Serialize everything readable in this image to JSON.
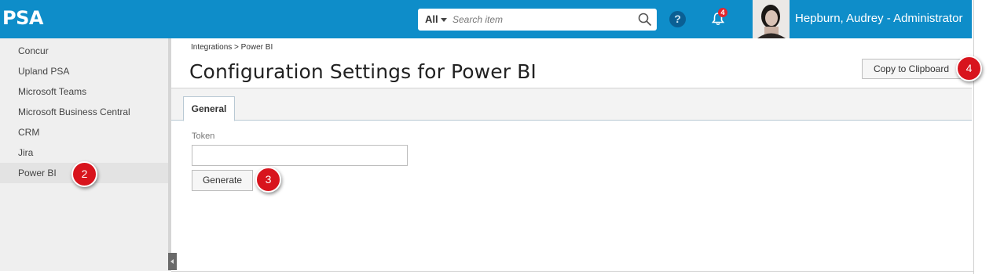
{
  "header": {
    "logo": "PSA",
    "search": {
      "scope": "All",
      "placeholder": "Search item"
    },
    "help_glyph": "?",
    "notifications": {
      "count": "4"
    },
    "user": {
      "name": "Hepburn, Audrey - Administrator"
    }
  },
  "sidebar": {
    "items": [
      {
        "label": "Concur"
      },
      {
        "label": "Upland PSA"
      },
      {
        "label": "Microsoft Teams"
      },
      {
        "label": "Microsoft Business Central"
      },
      {
        "label": "CRM"
      },
      {
        "label": "Jira"
      },
      {
        "label": "Power BI",
        "active": true
      }
    ]
  },
  "main": {
    "breadcrumb": "Integrations > Power BI",
    "title": "Configuration Settings for Power BI",
    "copy_button": "Copy to Clipboard",
    "tabs": [
      {
        "label": "General",
        "active": true
      }
    ],
    "token": {
      "label": "Token",
      "value": ""
    },
    "generate_button": "Generate"
  },
  "callouts": [
    "2",
    "3",
    "4"
  ],
  "colors": {
    "topbar": "#0e8dc9",
    "callout": "#d8141d",
    "sidebar": "#efefef"
  },
  "icons": [
    "search-icon",
    "help-icon",
    "bell-icon",
    "collapse-arrow-icon"
  ]
}
